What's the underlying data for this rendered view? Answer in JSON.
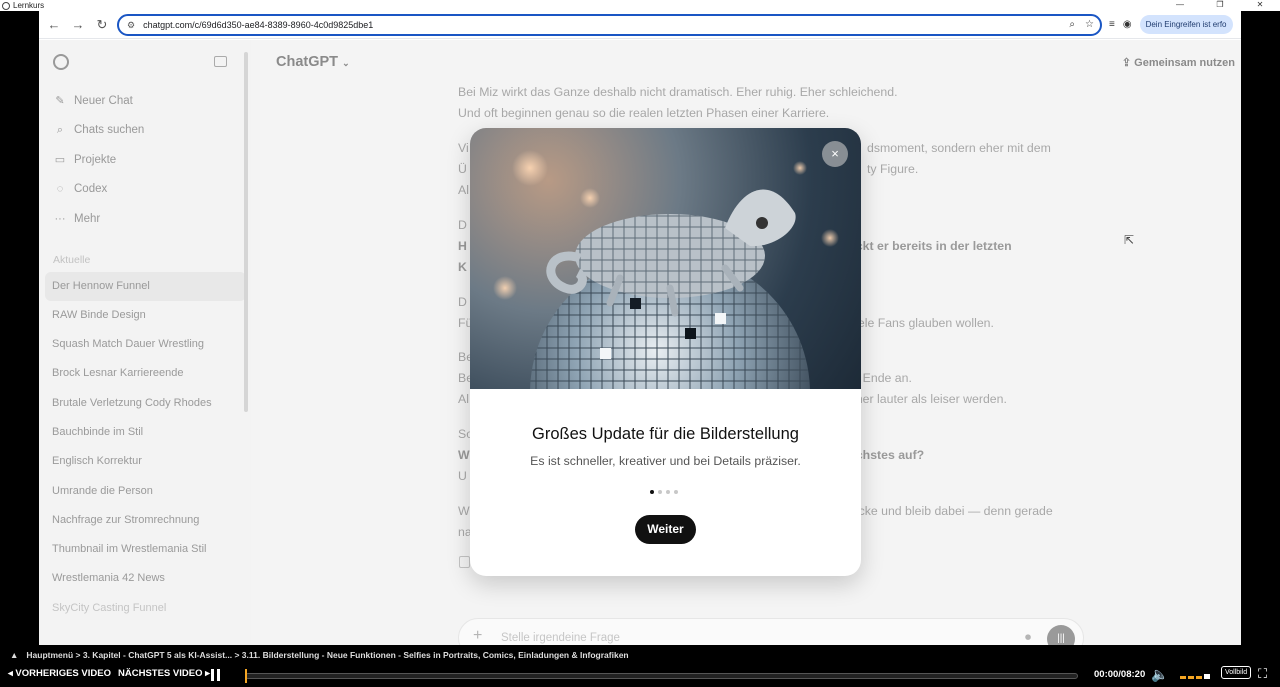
{
  "window": {
    "title": "Lernkurs"
  },
  "browser": {
    "url": "chatgpt.com/c/69d6d350-ae84-8389-8960-4c0d9825dbe1",
    "profile_pill": "Dein Eingreifen ist erfo"
  },
  "sidebar": {
    "menu": [
      {
        "label": "Neuer Chat",
        "icon": "edit-icon"
      },
      {
        "label": "Chats suchen",
        "icon": "search-icon"
      },
      {
        "label": "Projekte",
        "icon": "folder-icon"
      },
      {
        "label": "Codex",
        "icon": "codex-icon"
      },
      {
        "label": "Mehr",
        "icon": "more-icon"
      }
    ],
    "section_label": "Aktuelle",
    "chats": [
      "Der Hennow Funnel",
      "RAW Binde Design",
      "Squash Match Dauer Wrestling",
      "Brock Lesnar Karriereende",
      "Brutale Verletzung Cody Rhodes",
      "Bauchbinde im Stil",
      "Englisch Korrektur",
      "Umrande die Person",
      "Nachfrage zur Stromrechnung",
      "Thumbnail im Wrestlemania Stil",
      "Wrestlemania 42 News",
      "SkyCity Casting Funnel"
    ]
  },
  "header": {
    "model": "ChatGPT",
    "share_label": "Gemeinsam nutzen"
  },
  "messages": {
    "p1": [
      "Bei Miz wirkt das Ganze deshalb nicht dramatisch. Eher ruhig. Eher schleichend.",
      "Und oft beginnen genau so die realen letzten Phasen einer Karriere."
    ],
    "p2": [
      "Vi",
      "Ü",
      "Al"
    ],
    "p2_right": [
      "dsmoment, sondern eher mit dem",
      "ty Figure."
    ],
    "p3": [
      "D",
      "H",
      "K"
    ],
    "p3_right": "eckt er bereits in der letzten",
    "p4": [
      "D",
      "Fü"
    ],
    "p4_right": "viele Fans glauben wollen.",
    "p5": [
      "Be",
      "Be",
      "Al"
    ],
    "p5_right": [
      "m Ende an.",
      "eher lauter als leiser werden."
    ],
    "p6": [
      "So",
      "W",
      "U"
    ],
    "p6_right": "ächstes auf?",
    "p7": [
      "W",
      "na"
    ],
    "p7_right": "locke und bleib dabei — denn gerade"
  },
  "composer": {
    "placeholder": "Stelle irgendeine Frage"
  },
  "modal": {
    "title": "Großes Update für die Bilderstellung",
    "subtitle": "Es ist schneller, kreativer und bei Details präziser.",
    "button": "Weiter",
    "close": "×",
    "page_index": 1,
    "page_count": 4
  },
  "player": {
    "breadcrumb": "Hauptmenü > 3. Kapitel - ChatGPT 5 als KI-Assist... > 3.11. Bilderstellung - Neue Funktionen - Selfies in Portraits, Comics, Einladungen & Infografiken",
    "prev_label": "◂ VORHERIGES VIDEO",
    "next_label": "NÄCHSTES VIDEO ▸",
    "time": "00:00/08:20",
    "progress": 0.0,
    "fullscreen_label": "Vollbild"
  }
}
